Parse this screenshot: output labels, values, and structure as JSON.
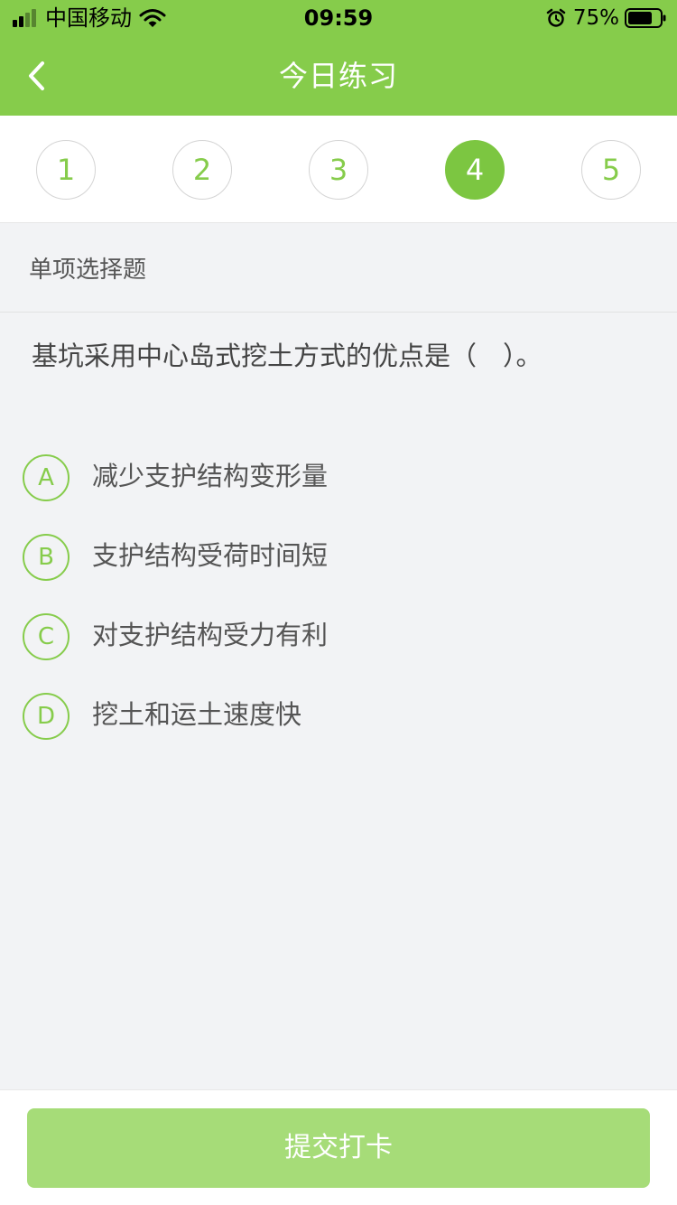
{
  "status_bar": {
    "carrier": "中国移动",
    "time": "09:59",
    "battery": "75%",
    "icons": [
      "signal-icon",
      "wifi-icon",
      "alarm-icon",
      "battery-icon"
    ]
  },
  "nav": {
    "title": "今日练习",
    "back_icon": "chevron-left-icon"
  },
  "question_numbers": [
    "1",
    "2",
    "3",
    "4",
    "5"
  ],
  "current_question": "4",
  "section_label": "单项选择题",
  "question": {
    "text": "基坑采用中心岛式挖土方式的优点是（　）。",
    "options": [
      {
        "letter": "A",
        "text": "减少支护结构变形量"
      },
      {
        "letter": "B",
        "text": "支护结构受荷时间短"
      },
      {
        "letter": "C",
        "text": "对支护结构受力有利"
      },
      {
        "letter": "D",
        "text": "挖土和运土速度快"
      }
    ]
  },
  "submit_label": "提交打卡",
  "colors": {
    "primary": "#86cc4b",
    "active_tab": "#7cc641",
    "submit_button": "#a6dc78",
    "background": "#f2f3f5"
  }
}
